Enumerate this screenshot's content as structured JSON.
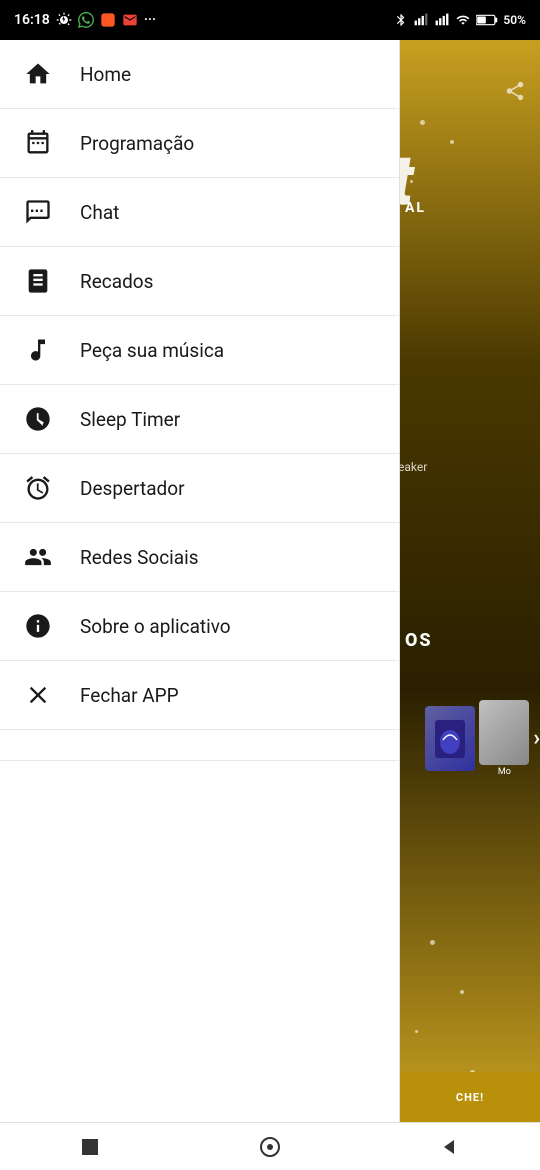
{
  "statusBar": {
    "time": "16:18",
    "batteryPercent": "50%"
  },
  "menu": {
    "items": [
      {
        "id": "home",
        "label": "Home",
        "icon": "home-icon"
      },
      {
        "id": "programacao",
        "label": "Programação",
        "icon": "calendar-icon"
      },
      {
        "id": "chat",
        "label": "Chat",
        "icon": "chat-icon"
      },
      {
        "id": "recados",
        "label": "Recados",
        "icon": "book-icon"
      },
      {
        "id": "peca-musica",
        "label": "Peça sua música",
        "icon": "music-icon"
      },
      {
        "id": "sleep-timer",
        "label": "Sleep Timer",
        "icon": "sleep-icon"
      },
      {
        "id": "despertador",
        "label": "Despertador",
        "icon": "alarm-icon"
      },
      {
        "id": "redes-sociais",
        "label": "Redes Sociais",
        "icon": "social-icon"
      },
      {
        "id": "sobre",
        "label": "Sobre o aplicativo",
        "icon": "info-icon"
      },
      {
        "id": "fechar",
        "label": "Fechar APP",
        "icon": "close-icon"
      }
    ]
  },
  "rightPanel": {
    "shareLabel": "share",
    "headingChar": "t",
    "subLabel": "AL",
    "speakerText": "eaker",
    "sectionText": "OS",
    "cardLabel": "Mo"
  },
  "bottomNav": {
    "stopLabel": "stop",
    "homeLabel": "home-circle",
    "backLabel": "back"
  }
}
